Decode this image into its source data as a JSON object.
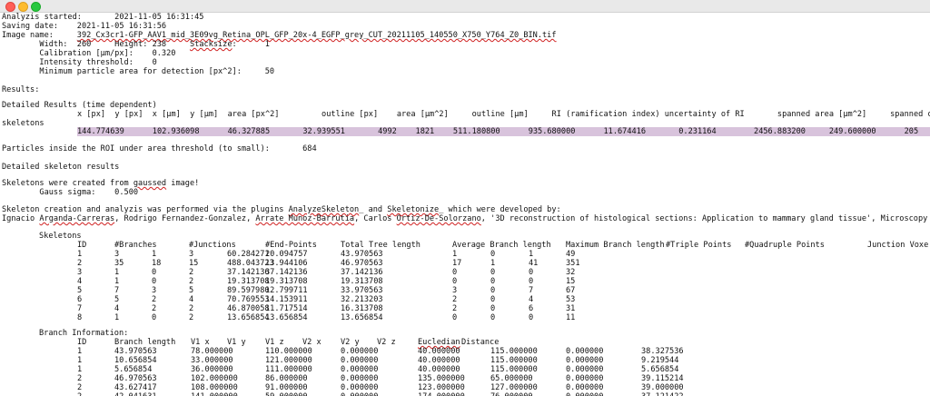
{
  "window": {
    "colors": {
      "close": "#ff5f57",
      "minimize": "#febc2e",
      "maximize": "#28c840",
      "highlight": "#d8c3dc"
    }
  },
  "header": {
    "line1": "Analyzis started:       2021-11-05 16:31:45",
    "line2": "Saving date:    2021-11-05 16:31:56",
    "line3_label": "Image name:     ",
    "image_name": "392_Cx3cr1-GFP_AAV1_mid_3E09vg_Retina_OPL_GFP_20x-4_EGFP_grey_CUT_20211105_140550_X750_Y764_Z0_BIN.tif",
    "line4a": "        Width:  260     Height: 238     ",
    "line4b": "Stacksize",
    "line4c": ":      1",
    "line5": "        Calibration [µm/px]:    0.320",
    "line6": "        Intensity threshold:    0",
    "line7": "        Minimum particle area for detection [px^2]:     50"
  },
  "results_label": "Results:",
  "detailed_label": "Detailed Results (time dependent)",
  "results_header": "x [px]  y [px]  x [µm]  y [µm]  area [px^2]         outline [px]    area [µm^2]     outline [µm]     RI (ramification index) uncertainty of RI       spanned area [µm^2]     spanned outli",
  "skeletons_label": "skeletons",
  "results_row": "144.774639      102.936098      46.327885       32.939551       4992    1821    511.180800      935.680000      11.674416       0.231164        2456.883200     249.600000      205",
  "particles_line": "Particles inside the ROI under area threshold (to small):       684",
  "detailed_skel_label": "Detailed skeleton results",
  "gaussed_a": "Skeletons were created from ",
  "gaussed_b": "gaussed",
  "gaussed_c": " image!",
  "gauss_sigma": "        Gauss sigma:    0.500",
  "plugin_a": "Skeleton creation and analyzis was performed via the plugins ",
  "plugin_b": "AnalyzeSkeleton",
  "plugin_c": "_ and ",
  "plugin_d": "Skeletonize",
  "plugin_e": "_ which were developed by:",
  "authors_a": "Ignacio ",
  "authors_b": "Arganda-Carreras",
  "authors_c": ", Rodrigo Fernandez-Gonzalez, ",
  "authors_d": "Arrate Munoz-Barrutia",
  "authors_e": ", Carlos ",
  "authors_f": "Ortiz-De-Solorzano",
  "authors_g": ", '3D reconstruction of histological sections: Application to mammary gland tissue', Microscopy",
  "skeletons_title": "Skeletons",
  "skeleton_headers": [
    "ID",
    "#Branches",
    "#Junctions",
    "#End-Points",
    "Total Tree length",
    "Average Branch length",
    "Maximum Branch length",
    "#Triple Points",
    "#Quadruple Points",
    "Junction Voxe"
  ],
  "skeleton_rows": [
    [
      "1",
      "3",
      "1",
      "3",
      "60.284271",
      "20.094757",
      "43.970563",
      "1",
      "0",
      "1",
      "49"
    ],
    [
      "2",
      "35",
      "18",
      "15",
      "488.043723",
      "13.944106",
      "46.970563",
      "17",
      "1",
      "41",
      "351"
    ],
    [
      "3",
      "1",
      "0",
      "2",
      "37.142136",
      "37.142136",
      "37.142136",
      "0",
      "0",
      "0",
      "32"
    ],
    [
      "4",
      "1",
      "0",
      "2",
      "19.313708",
      "19.313708",
      "19.313708",
      "0",
      "0",
      "0",
      "15"
    ],
    [
      "5",
      "7",
      "3",
      "5",
      "89.597980",
      "12.799711",
      "33.970563",
      "3",
      "0",
      "7",
      "67"
    ],
    [
      "6",
      "5",
      "2",
      "4",
      "70.769553",
      "14.153911",
      "32.213203",
      "2",
      "0",
      "4",
      "53"
    ],
    [
      "7",
      "4",
      "2",
      "2",
      "46.870058",
      "11.717514",
      "16.313708",
      "2",
      "0",
      "6",
      "31"
    ],
    [
      "8",
      "1",
      "0",
      "2",
      "13.656854",
      "13.656854",
      "13.656854",
      "0",
      "0",
      "0",
      "11"
    ]
  ],
  "branch_title": "Branch Information:",
  "branch_headers": [
    "ID",
    "Branch length",
    "V1 x",
    "V1 y",
    "V1 z",
    "V2 x",
    "V2 y",
    "V2 z",
    "Eucledian",
    "Distance"
  ],
  "branch_rows": [
    [
      "1",
      "43.970563",
      "78.000000",
      "110.000000",
      "0.000000",
      "40.000000",
      "115.000000",
      "0.000000",
      "38.327536"
    ],
    [
      "1",
      "10.656854",
      "33.000000",
      "121.000000",
      "0.000000",
      "40.000000",
      "115.000000",
      "0.000000",
      "9.219544"
    ],
    [
      "1",
      "5.656854",
      "36.000000",
      "111.000000",
      "0.000000",
      "40.000000",
      "115.000000",
      "0.000000",
      "5.656854"
    ],
    [
      "2",
      "46.970563",
      "102.000000",
      "86.000000",
      "0.000000",
      "135.000000",
      "65.000000",
      "0.000000",
      "39.115214"
    ],
    [
      "2",
      "43.627417",
      "108.000000",
      "91.000000",
      "0.000000",
      "123.000000",
      "127.000000",
      "0.000000",
      "39.000000"
    ],
    [
      "2",
      "42.041631",
      "141.000000",
      "59.000000",
      "0.000000",
      "174.000000",
      "76.000000",
      "0.000000",
      "37.121422"
    ]
  ]
}
